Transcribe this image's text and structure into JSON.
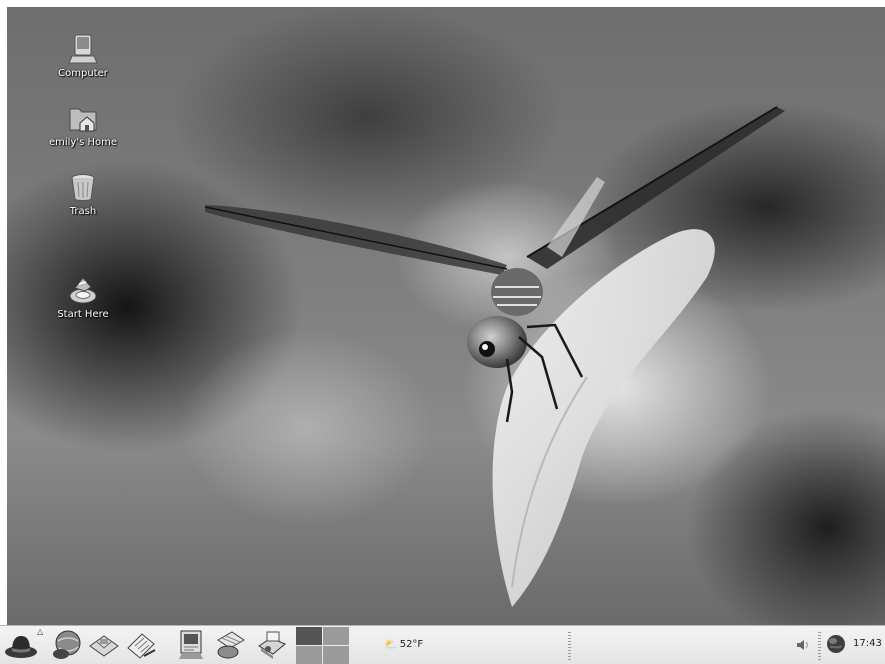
{
  "desktop": {
    "wallpaper": "dragonfly-on-leaf",
    "icons": [
      {
        "label": "Computer",
        "icon": "computer-icon"
      },
      {
        "label": "emily's Home",
        "icon": "home-folder-icon"
      },
      {
        "label": "Trash",
        "icon": "trash-icon"
      },
      {
        "label": "Start Here",
        "icon": "start-here-icon"
      }
    ]
  },
  "panel": {
    "launchers": [
      {
        "icon": "main-menu-hat-icon"
      },
      {
        "icon": "web-browser-icon"
      },
      {
        "icon": "email-icon"
      },
      {
        "icon": "text-editor-icon"
      },
      {
        "icon": "presentation-icon"
      },
      {
        "icon": "spreadsheet-icon"
      },
      {
        "icon": "printer-icon"
      }
    ],
    "pager": {
      "workspaces": 4,
      "active_workspace": 1
    },
    "weather": {
      "icon": "weather-icon",
      "temperature": "52°F"
    },
    "tray": {
      "speaker_icon": "volume-icon",
      "network_icon": "globe-icon"
    },
    "clock": "17:43"
  },
  "colors": {
    "panel_bg": "#e8e8e8",
    "active_workspace": "#545454",
    "inactive_workspace": "#9a9a9a"
  }
}
